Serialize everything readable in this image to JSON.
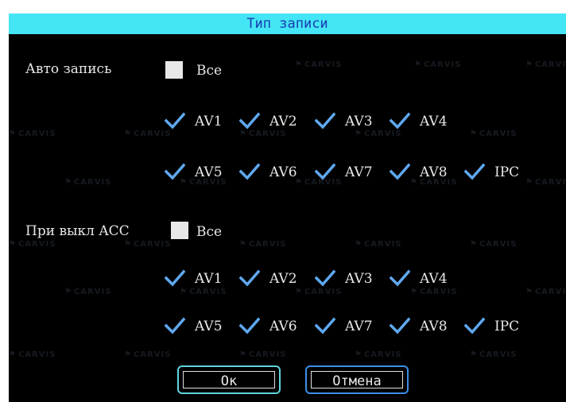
{
  "dialog": {
    "title": "Тип записи",
    "accent_color": "#44e5f5",
    "check_color": "#5fa8f0"
  },
  "watermark": "CARVIS",
  "sections": [
    {
      "label": "Авто запись",
      "all": {
        "label": "Все",
        "checked": false
      },
      "channels": [
        {
          "label": "AV1",
          "checked": true
        },
        {
          "label": "AV2",
          "checked": true
        },
        {
          "label": "AV3",
          "checked": true
        },
        {
          "label": "AV4",
          "checked": true
        },
        {
          "label": "AV5",
          "checked": true
        },
        {
          "label": "AV6",
          "checked": true
        },
        {
          "label": "AV7",
          "checked": true
        },
        {
          "label": "AV8",
          "checked": true
        },
        {
          "label": "IPC",
          "checked": true
        }
      ]
    },
    {
      "label": "При выкл ACC",
      "all": {
        "label": "Все",
        "checked": false
      },
      "channels": [
        {
          "label": "AV1",
          "checked": true
        },
        {
          "label": "AV2",
          "checked": true
        },
        {
          "label": "AV3",
          "checked": true
        },
        {
          "label": "AV4",
          "checked": true
        },
        {
          "label": "AV5",
          "checked": true
        },
        {
          "label": "AV6",
          "checked": true
        },
        {
          "label": "AV7",
          "checked": true
        },
        {
          "label": "AV8",
          "checked": true
        },
        {
          "label": "IPC",
          "checked": true
        }
      ]
    }
  ],
  "buttons": {
    "ok": "Ок",
    "cancel": "Отмена"
  }
}
